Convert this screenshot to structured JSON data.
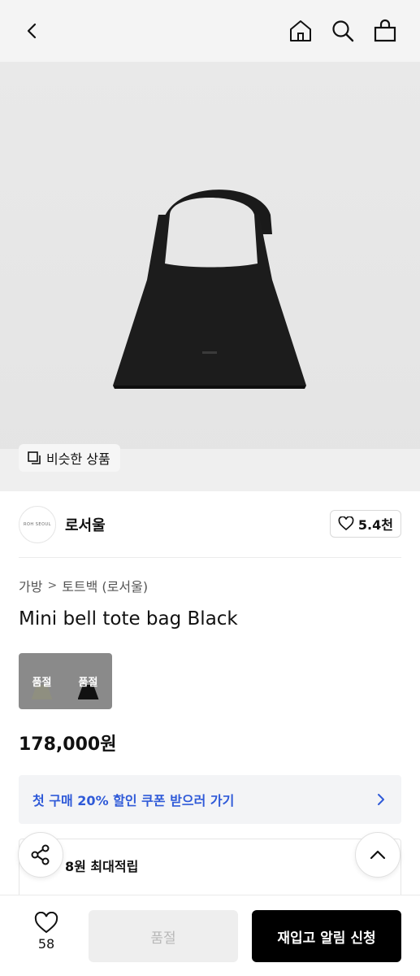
{
  "header": {
    "back_icon": "chevron-left-icon",
    "home_icon": "home-icon",
    "search_icon": "search-icon",
    "bag_icon": "shopping-bag-icon"
  },
  "hero": {
    "similar_label": "비슷한 상품"
  },
  "seller": {
    "name": "로서울",
    "logo_text": "ROH SEOUL",
    "likes": "5.4천"
  },
  "product": {
    "breadcrumb": [
      "가방",
      "토트백 (로서울)"
    ],
    "title": "Mini bell tote bag Black",
    "options": [
      {
        "label": "품절",
        "color": "#8f8f80"
      },
      {
        "label": "품절",
        "color": "#111111"
      }
    ],
    "price": "178,000원"
  },
  "coupon": {
    "text": "첫 구매 20% 할인 쿠폰 받으러 가기",
    "color": "#2f5ad8"
  },
  "points": {
    "text": "8원 최대적립"
  },
  "bottom_bar": {
    "wish_count": "58",
    "sold_out_label": "품절",
    "notify_label": "재입고 알림 신청"
  }
}
